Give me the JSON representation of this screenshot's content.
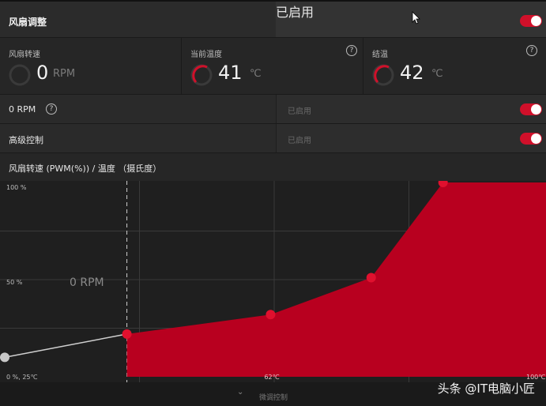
{
  "header": {
    "title": "风扇调整",
    "status": "已启用"
  },
  "stats": [
    {
      "caption": "风扇转速",
      "value": "0",
      "unit": "RPM"
    },
    {
      "caption": "当前温度",
      "value": "41",
      "unit": "℃"
    },
    {
      "caption": "结温",
      "value": "42",
      "unit": "℃"
    }
  ],
  "help_glyph": "?",
  "zero_rpm": {
    "label": "0 RPM",
    "status": "已启用"
  },
  "advanced": {
    "label": "高级控制",
    "status": "已启用"
  },
  "chart_title": "风扇转速 (PWM(%)) / 温度 （摄氏度）",
  "chart_data": {
    "type": "area",
    "y_tick_labels": [
      "100 %",
      "50 %",
      "0 %, 25℃"
    ],
    "x_tick_labels": [
      "62℃",
      "100℃"
    ],
    "zero_rpm_label": "0 RPM",
    "x": [
      25,
      42,
      62,
      76,
      86
    ],
    "y": [
      10,
      22,
      32,
      51,
      100
    ],
    "xlim": [
      25,
      100
    ],
    "ylim": [
      0,
      100
    ],
    "zero_rpm_until": 42,
    "fill_color": "#b8001f",
    "point_color": "#e0102e",
    "grid": true
  },
  "footer": {
    "label": "微调控制",
    "chevron": "⌄"
  },
  "watermark": "头条 @IT电脑小匠"
}
